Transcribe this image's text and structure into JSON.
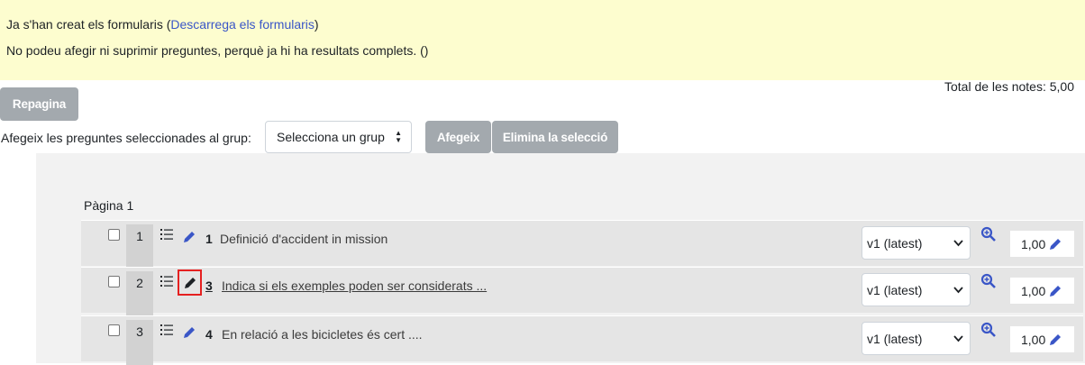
{
  "notice": {
    "line1_prefix": "Ja s'han creat els formularis (",
    "line1_link": "Descarrega els formularis",
    "line1_suffix": ")",
    "line2": "No podeu afegir ni suprimir preguntes, perquè ja hi ha resultats complets. ()"
  },
  "toolbar": {
    "repagina_label": "Repagina",
    "total_label": "Total de les notes: 5,00",
    "group_label": "Afegeix les preguntes seleccionades al grup:",
    "group_select_value": "Selecciona un grup",
    "afegeix_label": "Afegeix",
    "elimina_label": "Elimina la selecció"
  },
  "page": {
    "label": "Pàgina 1"
  },
  "questions": [
    {
      "slot": "1",
      "number": "1",
      "name": "Definició d'accident in mission",
      "version": "v1 (latest)",
      "mark": "1,00"
    },
    {
      "slot": "2",
      "number": "3",
      "name": "Indica si els exemples poden ser considerats ...",
      "version": "v1 (latest)",
      "mark": "1,00"
    },
    {
      "slot": "3",
      "number": "4",
      "name": "En relació a les bicicletes és cert ....",
      "version": "v1 (latest)",
      "mark": "1,00"
    }
  ],
  "colors": {
    "notice_bg": "#fdfdcf",
    "link": "#3a56c7",
    "disabled_button": "#a3a9ae",
    "icon_blue": "#3a56c7",
    "highlight_border": "#e52020"
  }
}
